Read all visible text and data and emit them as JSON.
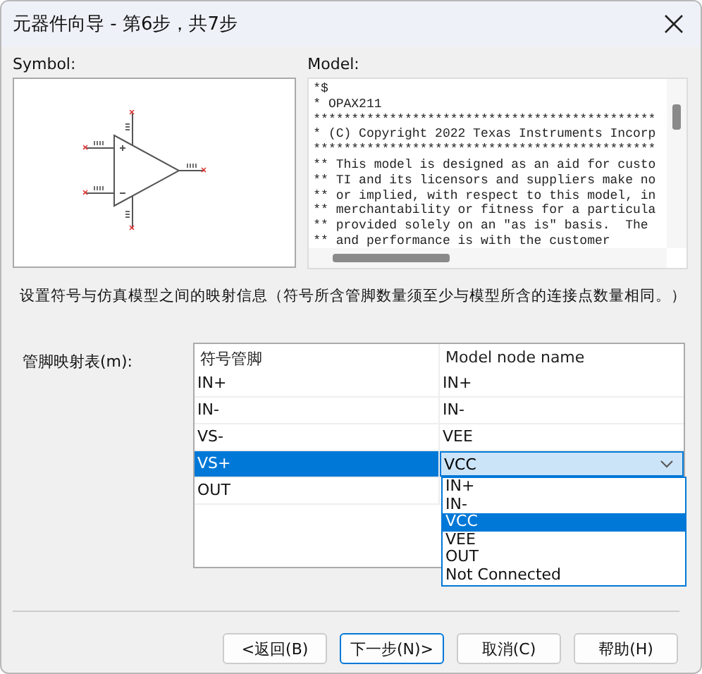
{
  "window": {
    "title": "元器件向导 - 第6步，共7步"
  },
  "symbol": {
    "label": "Symbol:"
  },
  "model": {
    "label": "Model:",
    "lines": [
      "*$",
      "* OPAX211",
      "*********************************************",
      "* (C) Copyright 2022 Texas Instruments Incorp",
      "*********************************************",
      "** This model is designed as an aid for custo",
      "** TI and its licensors and suppliers make no",
      "** or implied, with respect to this model, in",
      "** merchantability or fitness for a particula",
      "** provided solely on an \"as is\" basis.  The",
      "** and performance is with the customer"
    ]
  },
  "instruction": "设置符号与仿真模型之间的映射信息（符号所含管脚数量须至少与模型所含的连接点数量相同。）",
  "mapping": {
    "label": "管脚映射表(m):",
    "columns": [
      "符号管脚",
      "Model node name"
    ],
    "rows": [
      {
        "symbol_pin": "IN+",
        "model_node": "IN+",
        "selected": false
      },
      {
        "symbol_pin": "IN-",
        "model_node": "IN-",
        "selected": false
      },
      {
        "symbol_pin": "VS-",
        "model_node": "VEE",
        "selected": false
      },
      {
        "symbol_pin": "VS+",
        "model_node": "VCC",
        "selected": true
      },
      {
        "symbol_pin": "OUT",
        "model_node": "",
        "selected": false
      }
    ],
    "dropdown": {
      "options": [
        {
          "label": "IN+",
          "selected": false
        },
        {
          "label": "IN-",
          "selected": false
        },
        {
          "label": "VCC",
          "selected": true
        },
        {
          "label": "VEE",
          "selected": false
        },
        {
          "label": "OUT",
          "selected": false
        },
        {
          "label": "Not Connected",
          "selected": false
        }
      ]
    }
  },
  "buttons": [
    {
      "label": "<返回(B)",
      "focused": false
    },
    {
      "label": "下一步(N)>",
      "focused": true
    },
    {
      "label": "取消(C)",
      "focused": false
    },
    {
      "label": "帮助(H)",
      "focused": false
    }
  ]
}
